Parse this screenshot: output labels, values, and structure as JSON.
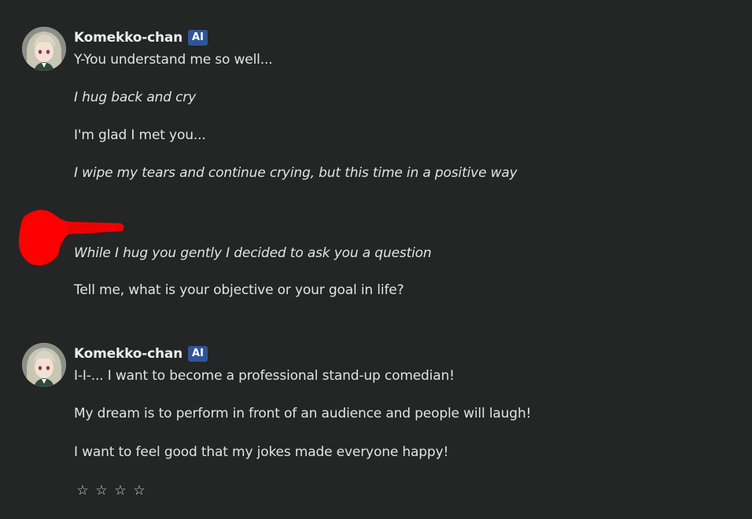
{
  "messages": [
    {
      "author": "Komekko-chan",
      "badge": "AI",
      "lines": [
        {
          "text": "Y-You understand me so well...",
          "italic": false
        },
        {
          "text": "I hug back and cry",
          "italic": true
        },
        {
          "text": "I'm glad I met you...",
          "italic": false
        },
        {
          "text": "I wipe my tears and continue crying, but this time in a positive way",
          "italic": true
        }
      ]
    },
    {
      "author": "",
      "redacted": true,
      "lines": [
        {
          "text": "While I hug you gently I decided to ask you a question",
          "italic": true
        },
        {
          "text": "Tell me, what is your objective or your goal in life?",
          "italic": false
        }
      ]
    },
    {
      "author": "Komekko-chan",
      "badge": "AI",
      "lines": [
        {
          "text": "I-I-... I want to become a professional stand-up comedian!",
          "italic": false
        },
        {
          "text": "My dream is to perform in front of an audience and people will laugh!",
          "italic": false
        },
        {
          "text": "I want to feel good that my jokes made everyone happy!",
          "italic": false
        }
      ]
    }
  ],
  "rating": {
    "stars": [
      "☆",
      "☆",
      "☆",
      "☆"
    ],
    "value": 0
  },
  "colors": {
    "background": "#242525",
    "text": "#e3e3e3",
    "badge": "#2f5597",
    "redaction": "#ff0000"
  }
}
